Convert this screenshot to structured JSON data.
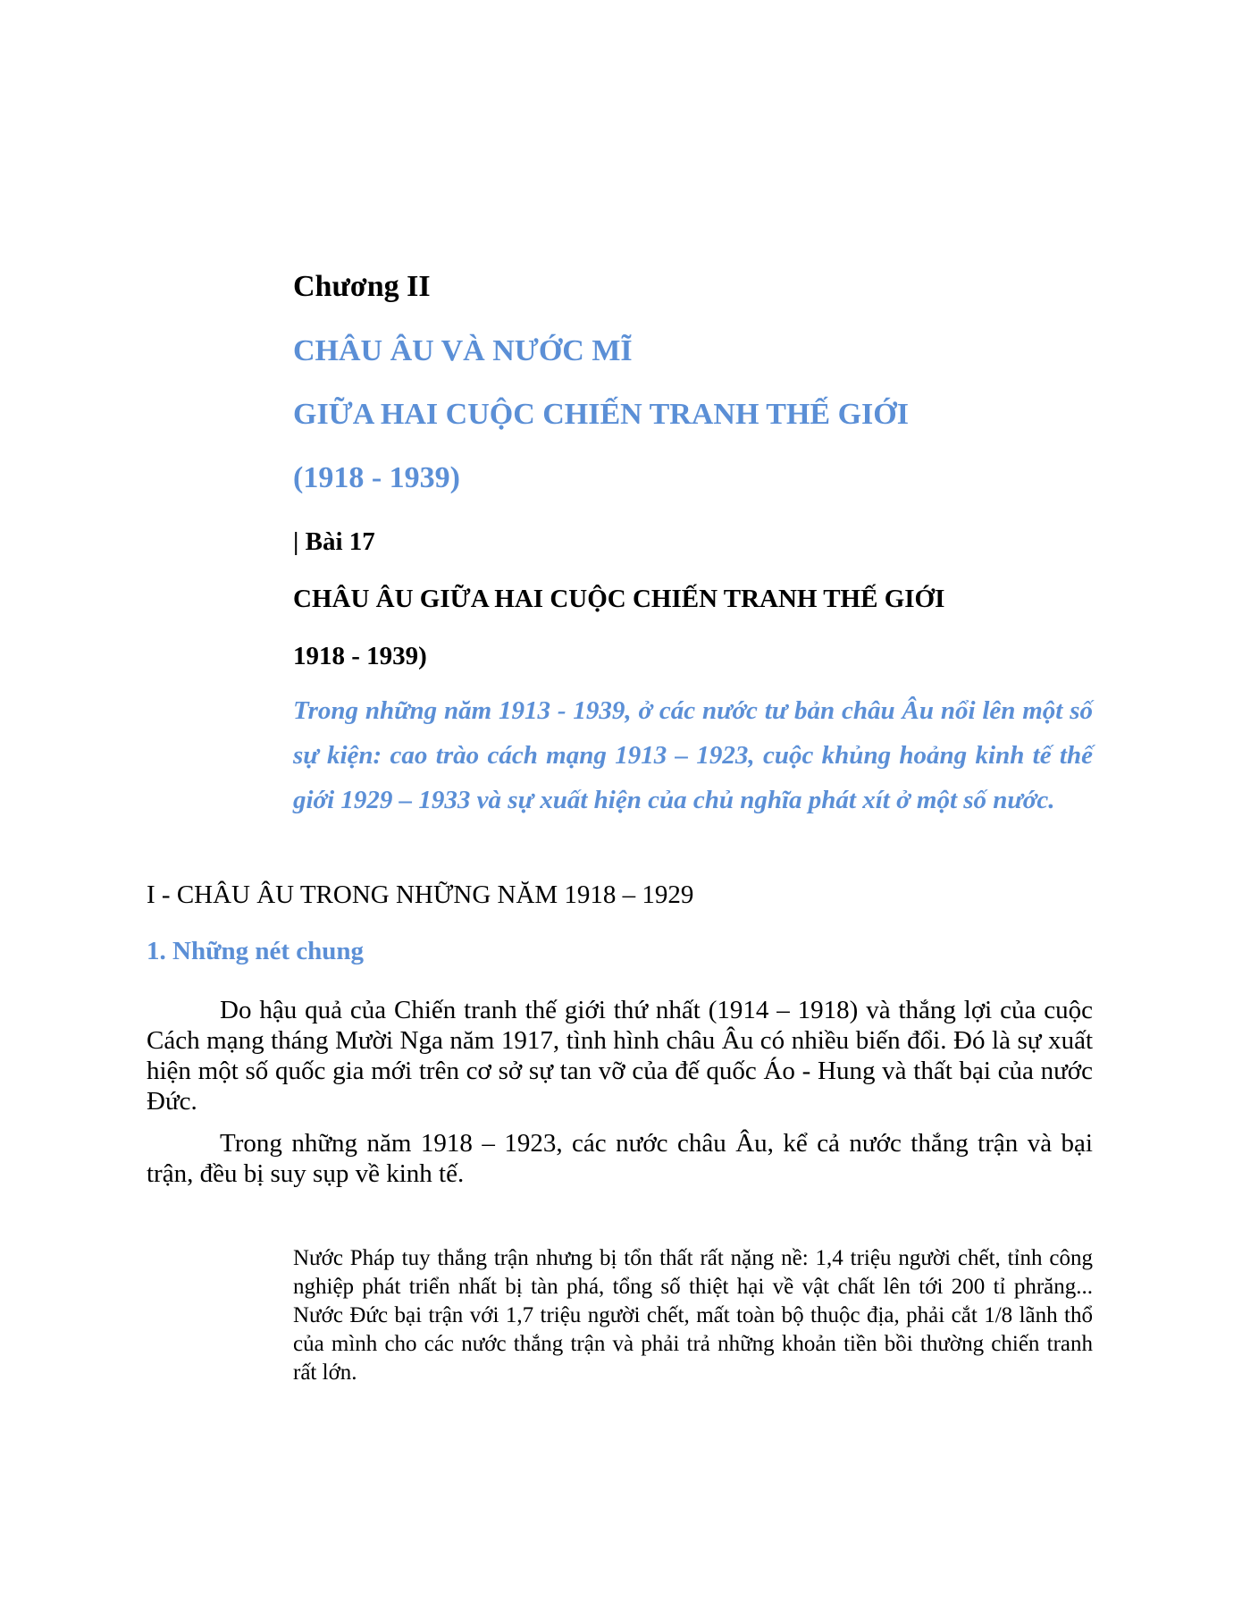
{
  "chapter": "Chương II",
  "title_line1": "CHÂU ÂU VÀ NƯỚC MĨ",
  "title_line2": "GIỮA HAI CUỘC CHIẾN TRANH THẾ GIỚI",
  "title_years": "(1918 - 1939)",
  "lesson_label": "| Bài 17",
  "lesson_title": "CHÂU ÂU GIỮA HAI CUỘC CHIẾN TRANH THẾ GIỚI",
  "lesson_years": "1918 - 1939)",
  "intro": "Trong những năm 1913 - 1939, ở các nước tư bản châu Âu nổi lên một số sự kiện: cao trào cách mạng 1913 – 1923, cuộc khủng hoảng kinh tế thế giới 1929 – 1933 và sự xuất hiện của chủ nghĩa phát xít ở một số nước.",
  "section_heading": "I - CHÂU ÂU TRONG NHỮNG NĂM 1918 – 1929",
  "subsection_heading": "1. Những nét chung",
  "paragraphs": [
    "Do hậu quả của Chiến tranh thế giới thứ nhất (1914 – 1918) và thắng lợi của cuộc Cách mạng tháng Mười Nga năm 1917, tình hình châu Âu có nhiều biến đổi. Đó là sự xuất hiện một số quốc gia mới trên cơ sở sự tan vỡ của đế quốc Áo - Hung và thất bại của nước Đức.",
    "Trong những năm 1918 – 1923, các nước châu Âu, kể cả nước thắng trận và bại trận, đều bị suy sụp về kinh tế."
  ],
  "note": "Nước Pháp tuy thắng trận nhưng bị tổn thất rất nặng nề: 1,4 triệu người chết, tỉnh công nghiệp phát triển nhất bị tàn phá, tổng số thiệt hại về vật chất lên tới 200 tỉ phrăng... Nước Đức bại trận với 1,7 triệu người chết, mất toàn bộ thuộc địa, phải cắt 1/8 lãnh thổ của mình cho các nước thắng trận và phải trả những khoản tiền bồi thường chiến tranh rất lớn."
}
